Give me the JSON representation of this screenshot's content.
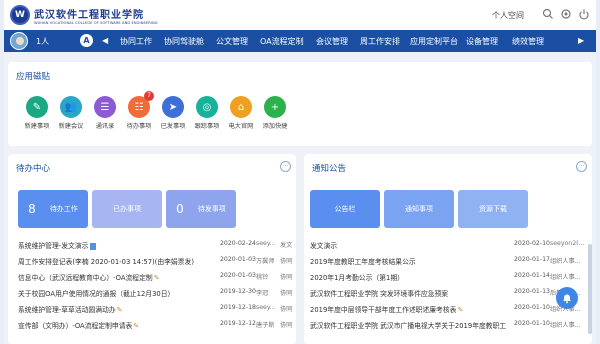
{
  "header": {
    "logo_seal": "W",
    "logo_cn": "武汉软件工程职业学院",
    "logo_en": "WUHAN VOCATIONAL COLLEGE OF SOFTWARE AND ENGINEERING",
    "personal_space": "个人空间"
  },
  "nav": {
    "user": "1人",
    "badge": "A",
    "prev_arrow": "◀",
    "next_arrow": "▶",
    "items": [
      "协同工作",
      "协同驾驶舱",
      "公文管理",
      "OA流程定制",
      "会议管理",
      "周工作安排",
      "应用定制平台",
      "设备管理",
      "绩效管理"
    ]
  },
  "tiles_panel": {
    "title": "应用磁贴",
    "tiles": [
      {
        "label": "新建事项",
        "icon": "new-item-icon",
        "glyph": "✎",
        "color": "#1ba784"
      },
      {
        "label": "新建会议",
        "icon": "meeting-icon",
        "glyph": "👥",
        "color": "#2aa6c7"
      },
      {
        "label": "通讯录",
        "icon": "contacts-icon",
        "glyph": "☰",
        "color": "#8d5ad6"
      },
      {
        "label": "待办事项",
        "icon": "todo-icon",
        "glyph": "☷",
        "color": "#ef6c3a",
        "badge": "7"
      },
      {
        "label": "已发事项",
        "icon": "sent-icon",
        "glyph": "➤",
        "color": "#3c6fd8"
      },
      {
        "label": "跟踪事项",
        "icon": "track-icon",
        "glyph": "◎",
        "color": "#16b39a"
      },
      {
        "label": "电大官网",
        "icon": "website-icon",
        "glyph": "⌂",
        "color": "#f0a020"
      },
      {
        "label": "添加快捷",
        "icon": "add-icon",
        "glyph": "+",
        "color": "#2bb24c"
      }
    ]
  },
  "todo_panel": {
    "title": "待办中心",
    "tabs": [
      {
        "count": "8",
        "label": "待办工作",
        "color": "#5a8ff0"
      },
      {
        "count": "",
        "label": "已办事项",
        "color": "#a7b6f2"
      },
      {
        "count": "0",
        "label": "待发事项",
        "color": "#8ea5ee"
      }
    ],
    "rows": [
      {
        "title": "系统维护管理-发文演示",
        "date": "2020-02-24",
        "who": "seey...",
        "type": "发文",
        "doc": true
      },
      {
        "title": "周工作安排登记表(李楠 2020-01-03 14:57)(由李娟票发)",
        "date": "2020-01-03",
        "who": "万冀师",
        "type": "协同"
      },
      {
        "title": "信息中心（武汉远程教育中心）-OA流程定制",
        "date": "2020-01-03",
        "who": "桃铃",
        "type": "协同",
        "clip": true
      },
      {
        "title": "关于校园OA用户使用情况的通报（截止12月30日）",
        "date": "2019-12-30",
        "who": "李冠",
        "type": "协同"
      },
      {
        "title": "系统维护管理-草草活动圆满动办",
        "date": "2019-12-18",
        "who": "seey...",
        "type": "协同",
        "clip": true
      },
      {
        "title": "宣传部（文明办）-OA流程定制申请表",
        "date": "2019-12-12",
        "who": "唐子斯",
        "type": "协同",
        "clip": true
      }
    ]
  },
  "notice_panel": {
    "title": "通知公告",
    "tabs": [
      {
        "label": "公告栏",
        "color": "#5a8ff0"
      },
      {
        "label": "通知事项",
        "color": "#7aa3f2"
      },
      {
        "label": "资源下载",
        "color": "#8fb2f3"
      }
    ],
    "rows": [
      {
        "title": "发文演示",
        "date": "2020-02-10",
        "who": "seeyon2(..."
      },
      {
        "title": "2019年度教职工年度考核结果公示",
        "date": "2020-01-17",
        "who": "组织人事..."
      },
      {
        "title": "2020年1月考勤公示（第1期）",
        "date": "2020-01-14",
        "who": "组织人事..."
      },
      {
        "title": "武汉软件工程职业学院 突发环境事件应急预案",
        "date": "2020-01-13",
        "who": "后勤保障..."
      },
      {
        "title": "2019年度中层领导干部年度工作述职述廉考核表",
        "date": "2020-01-10",
        "who": "组织人事...",
        "clip": true
      },
      {
        "title": "武汉软件工程职业学院 武汉市广播电视大学关于2019年度教职工",
        "date": "2020-01-10",
        "who": "组织人事..."
      }
    ]
  }
}
